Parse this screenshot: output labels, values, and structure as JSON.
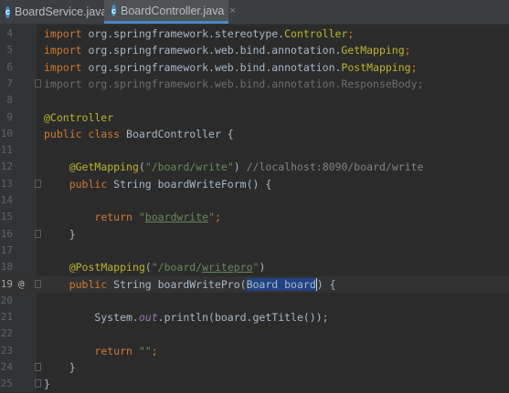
{
  "tabs": [
    {
      "icon": "c",
      "label": "BoardService.java",
      "close": "×"
    },
    {
      "icon": "c",
      "label": "BoardController.java",
      "close": "×"
    }
  ],
  "gutter_marker": "@",
  "lines": [
    {
      "num": "4",
      "t": [
        [
          "kw",
          "import "
        ],
        [
          "p",
          "org.springframework.stereotype."
        ],
        [
          "anno",
          "Controller"
        ],
        [
          "kw",
          ";"
        ]
      ]
    },
    {
      "num": "5",
      "t": [
        [
          "kw",
          "import "
        ],
        [
          "p",
          "org.springframework.web.bind.annotation."
        ],
        [
          "anno",
          "GetMapping"
        ],
        [
          "kw",
          ";"
        ]
      ]
    },
    {
      "num": "6",
      "t": [
        [
          "kw",
          "import "
        ],
        [
          "p",
          "org.springframework.web.bind.annotation."
        ],
        [
          "anno",
          "PostMapping"
        ],
        [
          "kw",
          ";"
        ]
      ]
    },
    {
      "num": "7",
      "t": [
        [
          "fade",
          "import org.springframework.web.bind.annotation.ResponseBody;"
        ]
      ]
    },
    {
      "num": "8",
      "t": []
    },
    {
      "num": "9",
      "t": [
        [
          "anno",
          "@Controller"
        ]
      ]
    },
    {
      "num": "10",
      "t": [
        [
          "kw",
          "public class "
        ],
        [
          "p",
          "BoardController {"
        ]
      ]
    },
    {
      "num": "11",
      "t": []
    },
    {
      "num": "12",
      "t": [
        [
          "p",
          "    "
        ],
        [
          "anno",
          "@GetMapping"
        ],
        [
          "p",
          "("
        ],
        [
          "str",
          "\"/board/write\""
        ],
        [
          "p",
          ") "
        ],
        [
          "cmt",
          "//localhost:8090/board/write"
        ]
      ]
    },
    {
      "num": "13",
      "t": [
        [
          "p",
          "    "
        ],
        [
          "kw",
          "public "
        ],
        [
          "p",
          "String boardWriteForm() {"
        ]
      ]
    },
    {
      "num": "14",
      "t": []
    },
    {
      "num": "15",
      "t": [
        [
          "p",
          "        "
        ],
        [
          "kw",
          "return "
        ],
        [
          "str",
          "\""
        ],
        [
          "strul",
          "boardwrite"
        ],
        [
          "str",
          "\""
        ],
        [
          "kw",
          ";"
        ]
      ]
    },
    {
      "num": "16",
      "t": [
        [
          "p",
          "    }"
        ]
      ]
    },
    {
      "num": "17",
      "t": []
    },
    {
      "num": "18",
      "t": [
        [
          "p",
          "    "
        ],
        [
          "anno",
          "@PostMapping"
        ],
        [
          "p",
          "("
        ],
        [
          "str",
          "\"/board/"
        ],
        [
          "strul",
          "writepro"
        ],
        [
          "str",
          "\""
        ],
        [
          "p",
          ")"
        ]
      ]
    },
    {
      "num": "19",
      "t": [
        [
          "p",
          "    "
        ],
        [
          "kw",
          "public "
        ],
        [
          "p",
          "String boardWritePro("
        ],
        [
          "sel",
          "Board board"
        ],
        [
          "caret",
          ""
        ],
        [
          "p",
          ") {"
        ]
      ]
    },
    {
      "num": "20",
      "t": []
    },
    {
      "num": "21",
      "t": [
        [
          "p",
          "        System."
        ],
        [
          "it",
          "out"
        ],
        [
          "p",
          ".println(board.getTitle());"
        ]
      ]
    },
    {
      "num": "22",
      "t": []
    },
    {
      "num": "23",
      "t": [
        [
          "p",
          "        "
        ],
        [
          "kw",
          "return "
        ],
        [
          "str",
          "\"\""
        ],
        [
          "kw",
          ";"
        ]
      ]
    },
    {
      "num": "24",
      "t": [
        [
          "p",
          "    }"
        ]
      ]
    },
    {
      "num": "25",
      "t": [
        [
          "p",
          "}"
        ]
      ]
    }
  ]
}
